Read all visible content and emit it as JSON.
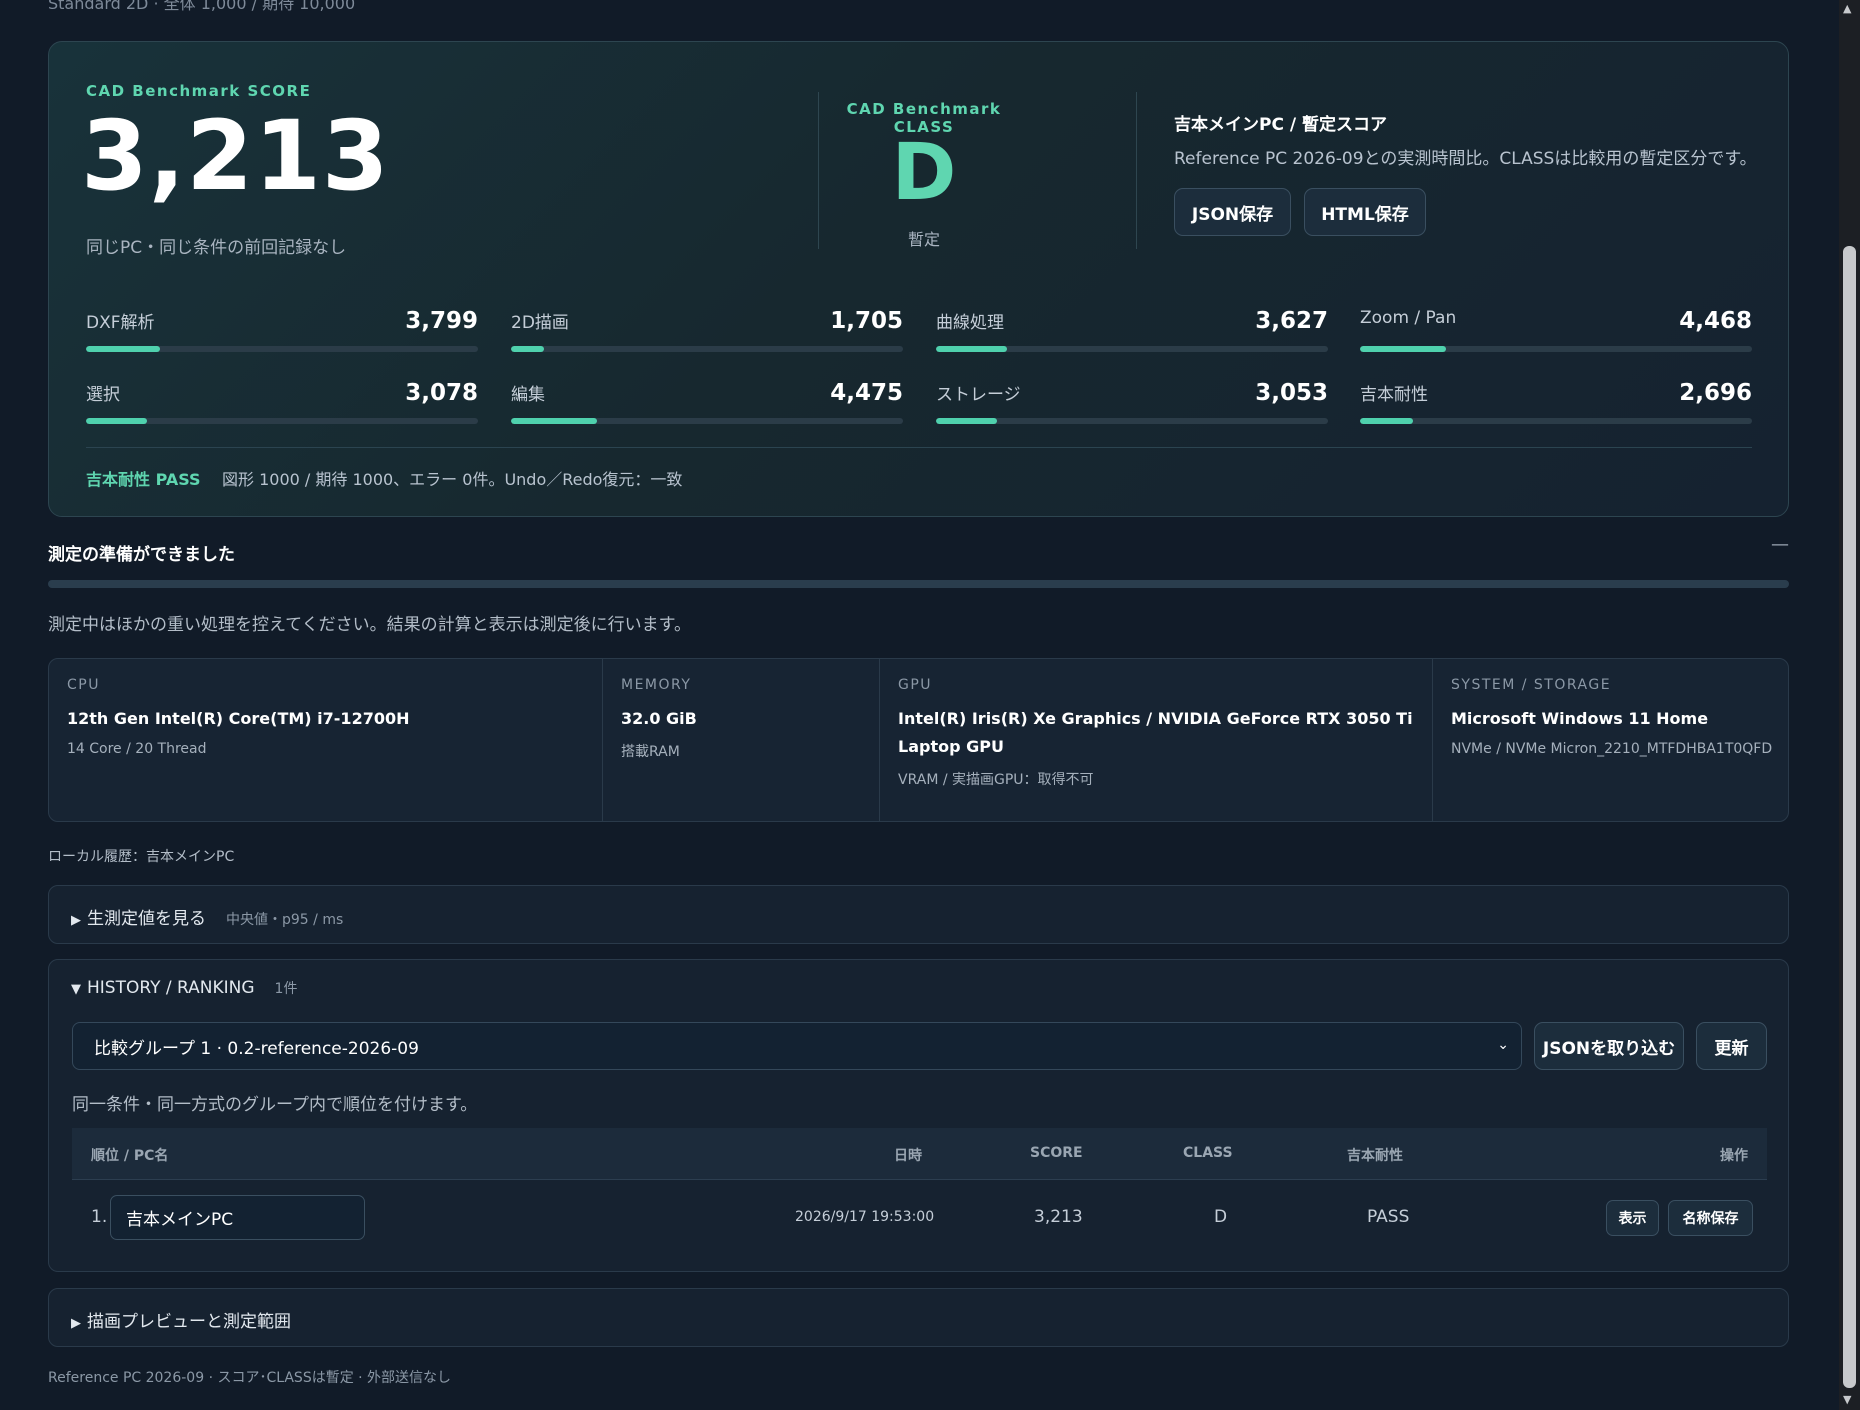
{
  "top_cut_text": "Standard 2D · 全体 1,000 / 期待 10,000",
  "hero": {
    "score_label": "CAD Benchmark SCORE",
    "score_value": "3,213",
    "score_note": "同じPC・同じ条件の前回記録なし",
    "class_label": "CAD Benchmark CLASS",
    "class_value": "D",
    "class_note": "暫定",
    "info_title": "吉本メインPC / 暫定スコア",
    "info_desc": "Reference PC 2026-09との実測時間比。CLASSは比較用の暫定区分です。",
    "json_save_label": "JSON保存",
    "html_save_label": "HTML保存",
    "metrics": [
      {
        "name": "DXF解析",
        "value": "3,799",
        "fill": 0.19
      },
      {
        "name": "2D描画",
        "value": "1,705",
        "fill": 0.085
      },
      {
        "name": "曲線処理",
        "value": "3,627",
        "fill": 0.18
      },
      {
        "name": "Zoom / Pan",
        "value": "4,468",
        "fill": 0.22
      },
      {
        "name": "選択",
        "value": "3,078",
        "fill": 0.155
      },
      {
        "name": "編集",
        "value": "4,475",
        "fill": 0.22
      },
      {
        "name": "ストレージ",
        "value": "3,053",
        "fill": 0.155
      },
      {
        "name": "吉本耐性",
        "value": "2,696",
        "fill": 0.135
      }
    ],
    "pass_tag": "吉本耐性 PASS",
    "pass_desc": "図形 1000 / 期待 1000、エラー 0件。Undo／Redo復元：一致"
  },
  "status": {
    "title": "測定の準備ができました",
    "collapse_glyph": "—",
    "note": "測定中はほかの重い処理を控えてください。結果の計算と表示は測定後に行います。"
  },
  "specs": [
    {
      "key": "CPU",
      "value": "12th Gen Intel(R) Core(TM) i7-12700H",
      "sub": "14 Core / 20 Thread"
    },
    {
      "key": "MEMORY",
      "value": "32.0 GiB",
      "sub": "搭載RAM"
    },
    {
      "key": "GPU",
      "value": "Intel(R) Iris(R) Xe Graphics / NVIDIA GeForce RTX 3050 Ti Laptop GPU",
      "sub": "VRAM / 実描画GPU：取得不可"
    },
    {
      "key": "SYSTEM / STORAGE",
      "value": "Microsoft Windows 11 Home",
      "sub": "NVMe / NVMe Micron_2210_MTFDHBA1T0QFD"
    }
  ],
  "local_history": "ローカル履歴：吉本メインPC",
  "raw_section": {
    "caret": "▶",
    "title": "生測定値を見る",
    "sub": "中央値・p95 / ms"
  },
  "history": {
    "caret": "▼",
    "title": "HISTORY / RANKING",
    "count": "1件",
    "group_selected": "比較グループ 1 · 0.2-reference-2026-09",
    "chevron_glyph": "⌄",
    "import_label": "JSONを取り込む",
    "refresh_label": "更新",
    "group_note": "同一条件・同一方式のグループ内で順位を付けます。",
    "columns": {
      "rank": "順位 / PC名",
      "date": "日時",
      "score": "SCORE",
      "class": "CLASS",
      "tolerance": "吉本耐性",
      "action": "操作"
    },
    "rows": [
      {
        "rank": "1.",
        "name": "吉本メインPC",
        "date": "2026/9/17 19:53:00",
        "score": "3,213",
        "class": "D",
        "tolerance": "PASS",
        "view_label": "表示",
        "save_name_label": "名称保存"
      }
    ]
  },
  "preview_section": {
    "caret": "▶",
    "title": "描画プレビューと測定範囲"
  },
  "footer": "Reference PC 2026-09 · スコア･CLASSは暫定 · 外部送信なし",
  "scrollbar": {
    "up_glyph": "▲",
    "down_glyph": "▼"
  },
  "colors": {
    "accent": "#5fd6b0",
    "background": "#111b28",
    "card": "#17282f"
  }
}
